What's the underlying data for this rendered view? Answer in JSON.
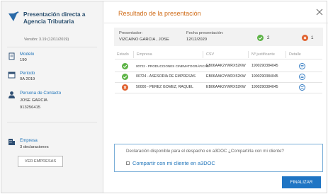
{
  "sidebar": {
    "app_title": "Presentación directa a Agencia Tributaria",
    "version": "Versión: 3.19 (12/11/2019)",
    "modelo_label": "Modelo",
    "modelo_value": "190",
    "periodo_label": "Periodo",
    "periodo_value": "0A 2019",
    "contacto_label": "Persona de Contacto",
    "contacto_name": "JOSE GARCIA",
    "contacto_phone": "913256415",
    "empresa_label": "Empresa",
    "empresa_value": "3 declaraciones",
    "ver_empresas": "VER EMPRESAS"
  },
  "main": {
    "title": "Resultado de la presentación",
    "presentador_label": "Presentador:",
    "presentador_value": "VIZCAINO GARCIA , JOSE",
    "fecha_label": "Fecha presentación:",
    "fecha_value": "12/12/2020",
    "ok_count": "2",
    "error_count": "1"
  },
  "table": {
    "headers": [
      "Estado",
      "Empresa",
      "CSV",
      "Nº justificante",
      "Detalle"
    ],
    "rows": [
      {
        "status": "ok",
        "empresa": "00722 - PRODUCCIONES CINEMATOGRÁFICAS",
        "csv": "EB06AAK2YWRX52KW",
        "justificante": "1900290384045"
      },
      {
        "status": "ok",
        "empresa": "00724 - ASESORIA DE EMPRESAS",
        "csv": "EB06AAK2YWRX52KW",
        "justificante": "1900290384045"
      },
      {
        "status": "error",
        "empresa": "50000 - PEREZ GOMEZ, RAQUEL",
        "csv": "EB06AAK2YWRX52KW",
        "justificante": "1900290384045"
      }
    ]
  },
  "share": {
    "question": "Declaración disponible para el despacho en a3DOC ¿Compartirla con mi cliente?",
    "checkbox_label": "Compartir con mi cliente en a3DOC"
  },
  "footer": {
    "finalizar": "FINALIZAR"
  },
  "colors": {
    "accent": "#1f75c4",
    "title": "#d06d1a",
    "ok": "#5cb345",
    "error": "#e0622f"
  },
  "icons": {
    "logo": "agency-logo-icon",
    "modelo": "document-icon",
    "periodo": "calendar-icon",
    "contacto": "person-icon",
    "empresa": "building-icon",
    "close": "close-icon",
    "ok": "check-circle-icon",
    "error": "error-circle-icon",
    "detail": "view-detail-icon"
  }
}
